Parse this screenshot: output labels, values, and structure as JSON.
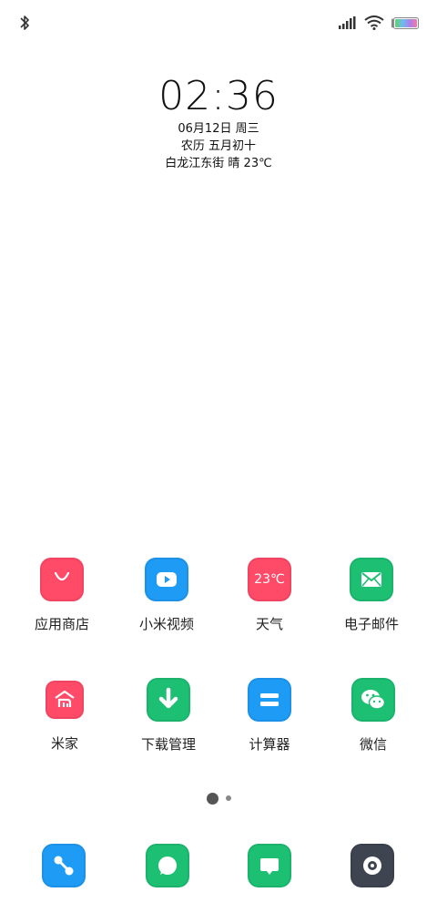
{
  "status_bar": {
    "icons": [
      "bluetooth-icon",
      "cellular-signal-icon",
      "wifi-icon",
      "battery-icon"
    ]
  },
  "clock": {
    "time": "02:36",
    "date": "06月12日 周三",
    "lunar": "农历 五月初十",
    "weather": "白龙江东街 晴 23℃"
  },
  "apps": [
    {
      "label": "应用商店",
      "icon": "shopping-bag-icon",
      "color": "#FF4A68"
    },
    {
      "label": "小米视频",
      "icon": "play-icon",
      "color": "#1E9BF5"
    },
    {
      "label": "天气",
      "icon": "weather-temperature-icon",
      "color": "#FF4A68",
      "icon_text": "23℃"
    },
    {
      "label": "电子邮件",
      "icon": "mail-icon",
      "color": "#1DBF73"
    },
    {
      "label": "米家",
      "icon": "mijia-home-icon",
      "color": "#FF4A68"
    },
    {
      "label": "下载管理",
      "icon": "download-icon",
      "color": "#1DBF73"
    },
    {
      "label": "计算器",
      "icon": "calculator-icon",
      "color": "#1E9BF5"
    },
    {
      "label": "微信",
      "icon": "wechat-icon",
      "color": "#1DBF73"
    }
  ],
  "page_indicator": {
    "current": 1,
    "total": 2
  },
  "dock": [
    {
      "icon": "phone-dialer-icon",
      "color": "#1E9BF5"
    },
    {
      "icon": "messages-icon",
      "color": "#1DBF73"
    },
    {
      "icon": "chat-bubble-icon",
      "color": "#1DBF73"
    },
    {
      "icon": "camera-icon",
      "color": "#3E4450"
    }
  ]
}
